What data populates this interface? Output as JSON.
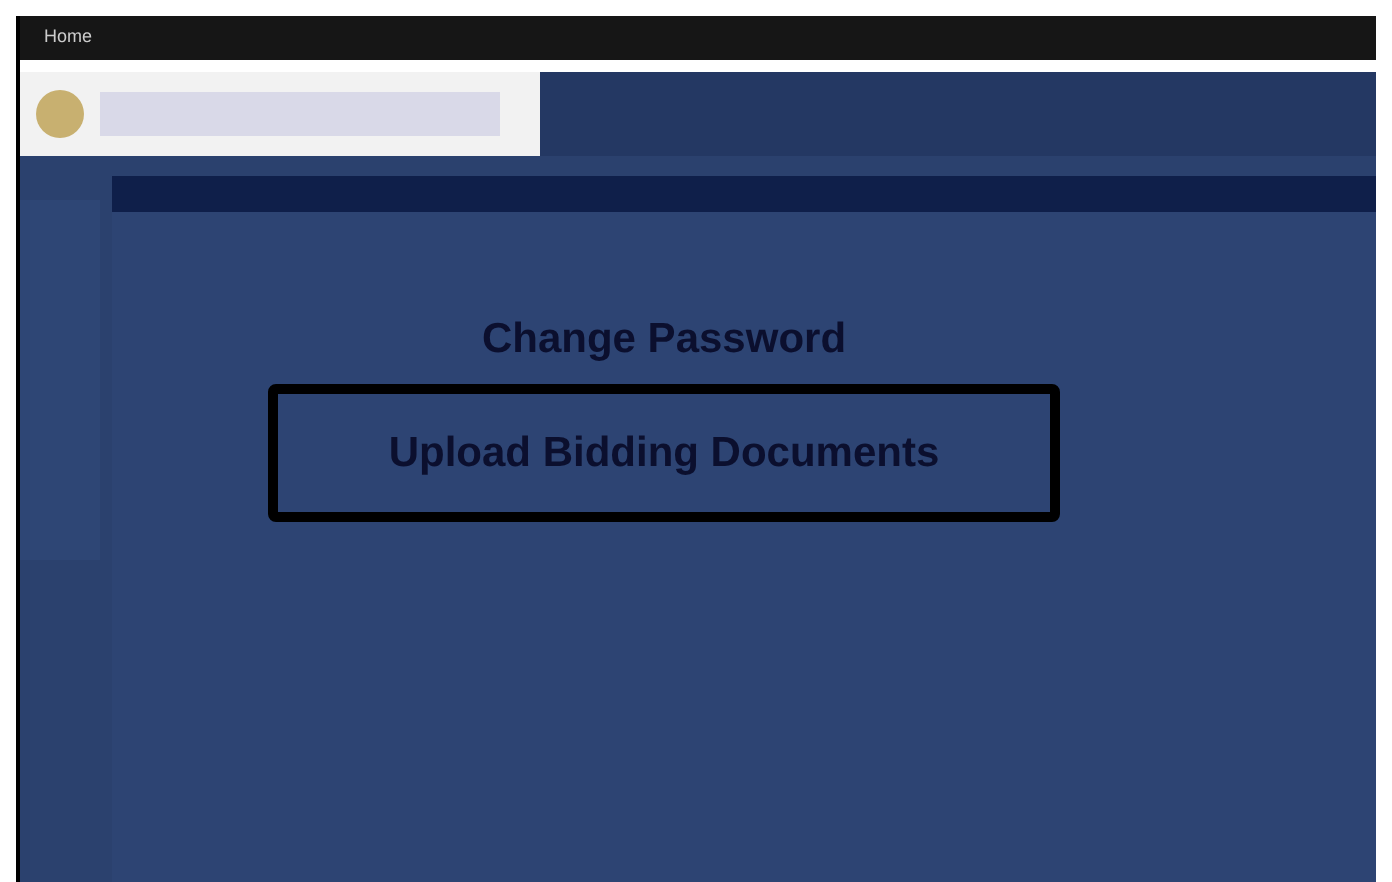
{
  "top_bar": {
    "title": "Home"
  },
  "links": [
    {
      "label": "Change Password",
      "highlighted": false
    },
    {
      "label": "Upload Bidding Documents",
      "highlighted": true
    }
  ]
}
